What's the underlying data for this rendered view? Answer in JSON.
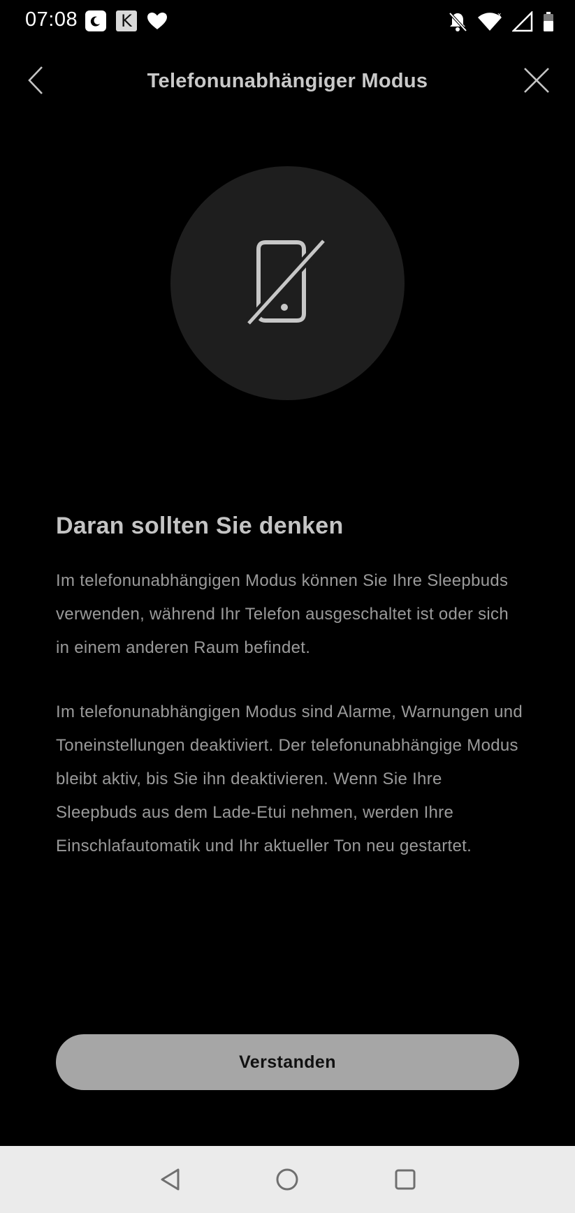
{
  "status_bar": {
    "time": "07:08",
    "left_icons": [
      "moon-app-icon",
      "k-app-icon",
      "heart-app-icon"
    ],
    "k_app_letter": "K",
    "right_icons": [
      "bell-muted-icon",
      "wifi-icon",
      "signal-icon",
      "battery-icon"
    ]
  },
  "app_bar": {
    "title": "Telefonunabhängiger Modus",
    "back_icon": "chevron-left-icon",
    "close_icon": "close-icon"
  },
  "hero": {
    "icon": "phone-off-icon"
  },
  "content": {
    "heading": "Daran sollten Sie denken",
    "paragraph_1": "Im telefonunabhängigen Modus können Sie Ihre Sleepbuds verwenden, während Ihr Telefon ausgeschaltet ist oder sich in einem anderen Raum befindet.",
    "paragraph_2": "Im telefonunabhängigen Modus sind Alarme, Warnungen und Toneinstellungen deaktiviert. Der telefonunabhängige Modus bleibt aktiv, bis Sie ihn deaktivieren. Wenn Sie Ihre Sleepbuds aus dem Lade-Etui nehmen, werden Ihre Einschlafautomatik und Ihr aktueller Ton neu gestartet."
  },
  "primary_button": {
    "label": "Verstanden"
  },
  "nav_bar": {
    "icons": [
      "nav-back-icon",
      "nav-home-icon",
      "nav-recents-icon"
    ]
  },
  "colors": {
    "background": "#000000",
    "title_text": "#c9c9c9",
    "heading_text": "#c4c4c4",
    "body_text": "#9a9a9a",
    "hero_circle": "#1e1e1e",
    "button_bg": "#a6a6a6",
    "button_text": "#111111",
    "nav_bar_bg": "#ebebeb"
  }
}
